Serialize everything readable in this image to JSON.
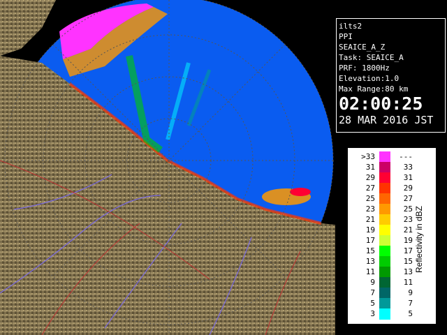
{
  "info": {
    "site": "ilts2",
    "scan_type": "PPI",
    "product": "SEAICE_A_Z",
    "task": "Task: SEAICE_A",
    "prf": "PRF: 1800Hz",
    "elevation": "Elevation:1.0",
    "max_range": "Max Range:80 km",
    "time": "02:00:25",
    "date": "28 MAR 2016 JST"
  },
  "legend": {
    "title": "Reflectivity in dBZ",
    "rows": [
      {
        "left": ">33",
        "right": "---",
        "color": "#ff33ff"
      },
      {
        "left": "31",
        "right": "33",
        "color": "#cc0066"
      },
      {
        "left": "29",
        "right": "31",
        "color": "#ff0033"
      },
      {
        "left": "27",
        "right": "29",
        "color": "#ff3300"
      },
      {
        "left": "25",
        "right": "27",
        "color": "#ff6600"
      },
      {
        "left": "23",
        "right": "25",
        "color": "#ff9900"
      },
      {
        "left": "21",
        "right": "23",
        "color": "#ffcc00"
      },
      {
        "left": "19",
        "right": "21",
        "color": "#ffff00"
      },
      {
        "left": "17",
        "right": "19",
        "color": "#ccff33"
      },
      {
        "left": "15",
        "right": "17",
        "color": "#00ff00"
      },
      {
        "left": "13",
        "right": "15",
        "color": "#00cc00"
      },
      {
        "left": "11",
        "right": "13",
        "color": "#009900"
      },
      {
        "left": "9",
        "right": "11",
        "color": "#006633"
      },
      {
        "left": "7",
        "right": "9",
        "color": "#006666"
      },
      {
        "left": "5",
        "right": "7",
        "color": "#009999"
      },
      {
        "left": "3",
        "right": "5",
        "color": "#00ffff"
      }
    ]
  },
  "colors": {
    "sea": "#0a5cf0",
    "land": "#8a7a55",
    "land_dark": "#4a4028",
    "river": "#7a6ae0",
    "boundary": "#c03030"
  }
}
